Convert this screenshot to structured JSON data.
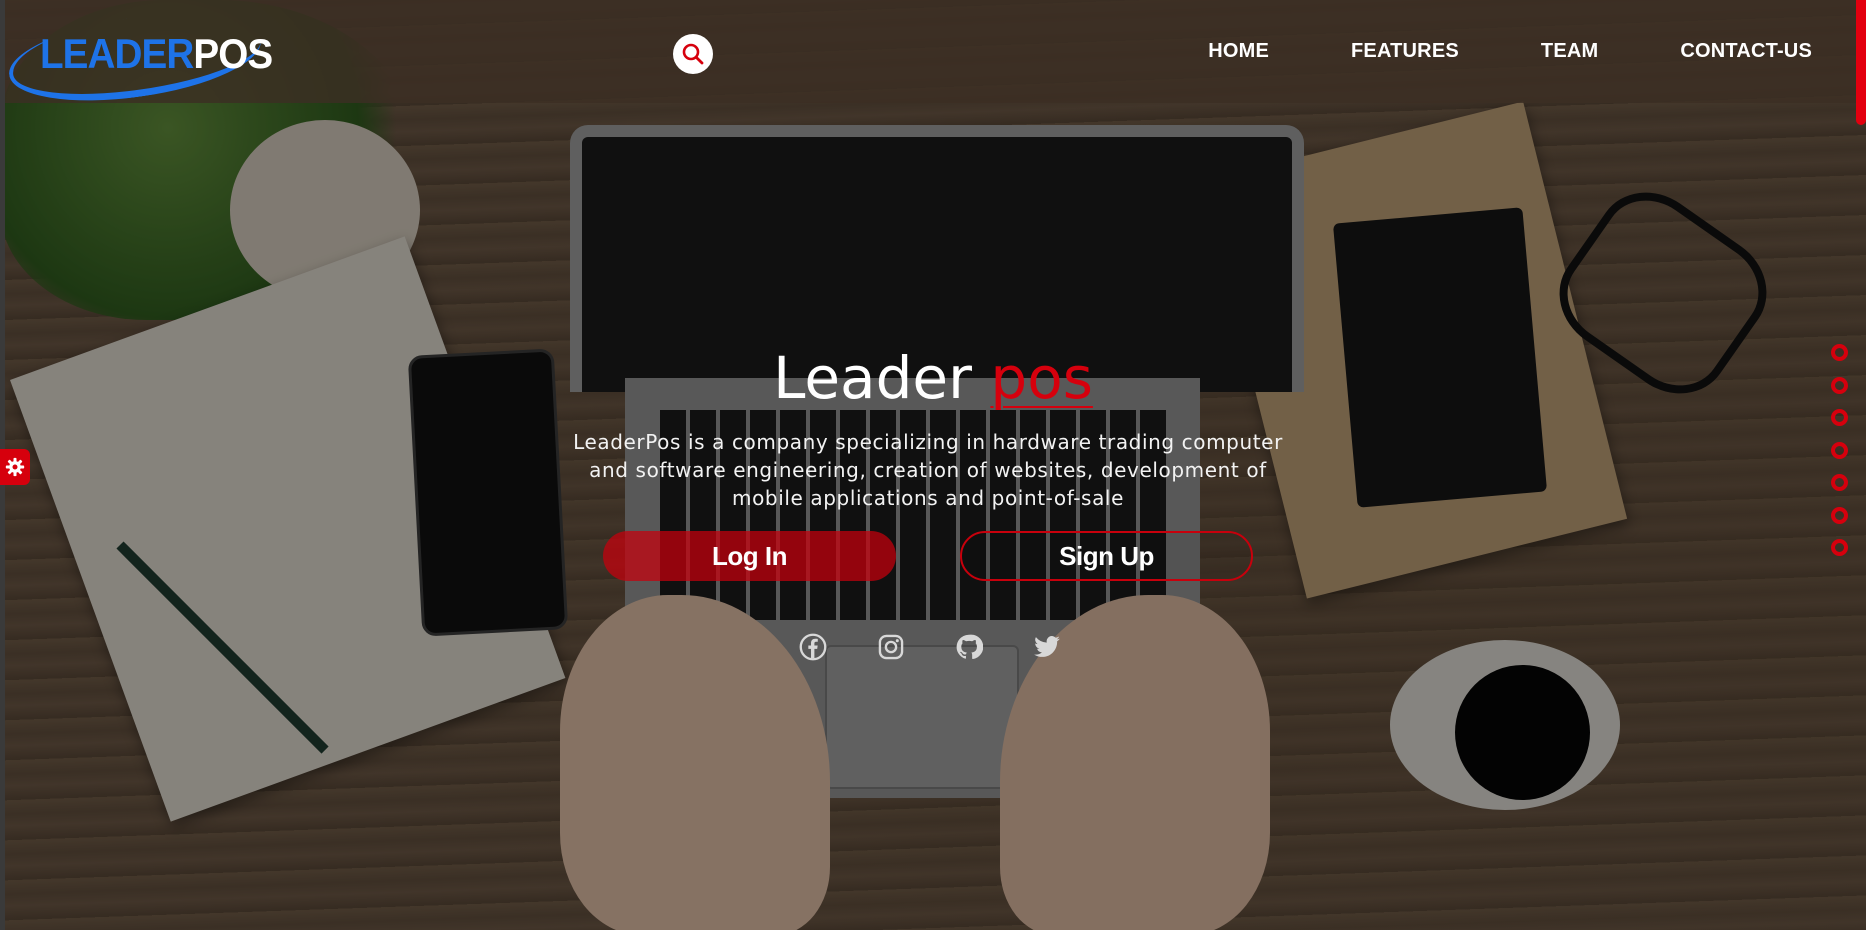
{
  "brand": {
    "logo_part1": "LEADER",
    "logo_part2": "POS"
  },
  "nav": {
    "items": [
      {
        "label": "HOME"
      },
      {
        "label": "FEATURES"
      },
      {
        "label": "TEAM"
      },
      {
        "label": "CONTACT-US"
      }
    ]
  },
  "hero": {
    "title_main": "Leader",
    "title_accent": "pos",
    "description": "LeaderPos is a company specializing in hardware trading computer and software engineering, creation of websites, development of mobile applications and point-of-sale",
    "login_label": "Log In",
    "signup_label": "Sign Up"
  },
  "social": [
    "facebook-icon",
    "instagram-icon",
    "github-icon",
    "twitter-icon"
  ],
  "section_dots_count": 7,
  "colors": {
    "accent": "#d6000d",
    "brand_blue": "#1e73e8"
  }
}
